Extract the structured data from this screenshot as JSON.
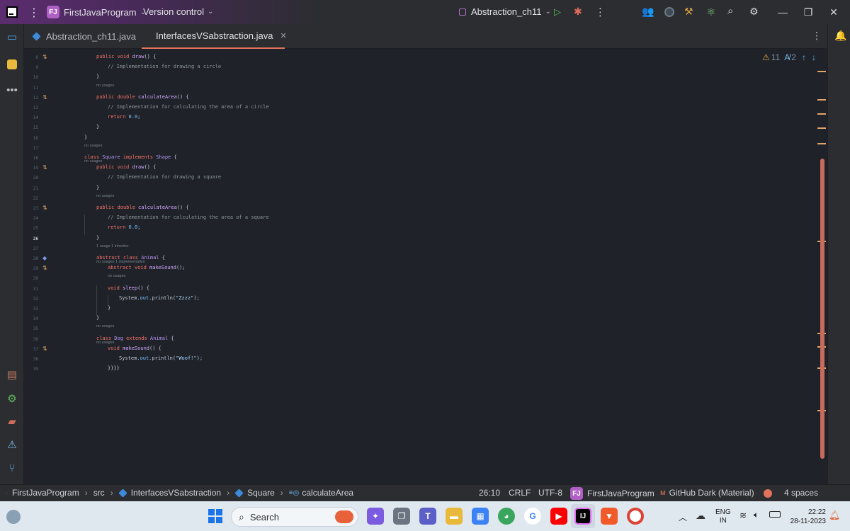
{
  "titlebar": {
    "project_badge": "FJ",
    "project_name": "FirstJavaProgram",
    "vcs": "Version control",
    "run_config": "Abstraction_ch11"
  },
  "tabs": [
    {
      "label": "Abstraction_ch11.java"
    },
    {
      "label": "InterfacesVSabstraction.java"
    }
  ],
  "inspection": {
    "warnings": "11",
    "typos": "2"
  },
  "code_lines": [
    {
      "ln": "8"
    },
    {
      "ln": "9"
    },
    {
      "ln": "10"
    },
    {
      "ln": "11"
    },
    {
      "ln": "12"
    },
    {
      "ln": "13"
    },
    {
      "ln": "14"
    },
    {
      "ln": "15"
    },
    {
      "ln": "16"
    },
    {
      "ln": "17"
    },
    {
      "ln": "18"
    },
    {
      "ln": "19"
    },
    {
      "ln": "20"
    },
    {
      "ln": "21"
    },
    {
      "ln": "22"
    },
    {
      "ln": "23"
    },
    {
      "ln": "24"
    },
    {
      "ln": "25"
    },
    {
      "ln": "26"
    },
    {
      "ln": "27"
    },
    {
      "ln": "28"
    },
    {
      "ln": "29"
    },
    {
      "ln": "30"
    },
    {
      "ln": "31"
    },
    {
      "ln": "32"
    },
    {
      "ln": "33"
    },
    {
      "ln": "34"
    },
    {
      "ln": "35"
    },
    {
      "ln": "36"
    },
    {
      "ln": "37"
    },
    {
      "ln": "38"
    },
    {
      "ln": "39"
    }
  ],
  "code": {
    "l8": [
      "public",
      " ",
      "void",
      " ",
      "draw",
      "() {"
    ],
    "l9": "// Implementation for drawing a circle",
    "l10": "}",
    "h12": "no usages",
    "l12": [
      "public",
      " ",
      "double",
      " ",
      "calculateArea",
      "() {"
    ],
    "l13": "// Implementation for calculating the area of a circle",
    "l14": [
      "return",
      " ",
      "0.0",
      ";"
    ],
    "l15": "}",
    "l16": "}",
    "h18": "no usages",
    "l18": [
      "class",
      " ",
      "Square",
      " ",
      "implements",
      " ",
      "Shape",
      " {"
    ],
    "h19": "no usages",
    "l19": [
      "public",
      " ",
      "void",
      " ",
      "draw",
      "() {"
    ],
    "l20": "// Implementation for drawing a square",
    "l21": "}",
    "h23": "no usages",
    "l23": [
      "public",
      " ",
      "double",
      " ",
      "calculateArea",
      "() ",
      "{"
    ],
    "l24": "// Implementation for calculating the area of a square",
    "l25": [
      "return",
      " ",
      "0.0",
      ";"
    ],
    "l26": "}",
    "h28": "1 usage   1 inheritor",
    "l28": [
      "abstract",
      " ",
      "class",
      " ",
      "Animal",
      " {"
    ],
    "h29": "no usages   1 implementation",
    "l29": [
      "abstract",
      " ",
      "void",
      " ",
      "makeSound",
      "();"
    ],
    "h31": "no usages",
    "l31": [
      "void",
      " ",
      "sleep",
      "() {"
    ],
    "l32": [
      "System.",
      "out",
      ".println(",
      "\"Zzzz\"",
      ");"
    ],
    "l33": "}",
    "l34": "}",
    "h36": "no usages",
    "l36": [
      "class",
      " ",
      "Dog",
      " ",
      "extends",
      " ",
      "Animal",
      " {"
    ],
    "h37": "no usages",
    "l37": [
      "void",
      " ",
      "makeSound",
      "() {"
    ],
    "l38": [
      "System.",
      "out",
      ".println(",
      "\"Woof!\"",
      ");"
    ],
    "l39": "}}}}"
  },
  "statusbar": {
    "breadcrumb": [
      "FirstJavaProgram",
      "src",
      "InterfacesVSabstraction",
      "Square",
      "calculateArea"
    ],
    "position": "26:10",
    "line_sep": "CRLF",
    "encoding": "UTF-8",
    "project_badge": "FJ",
    "project": "FirstJavaProgram",
    "theme": "GitHub Dark (Material)",
    "indent": "4 spaces"
  },
  "taskbar": {
    "search_placeholder": "Search",
    "lang": "ENG",
    "region": "IN",
    "time": "22:22",
    "date": "28-11-2023"
  },
  "colors": {
    "accent": "#e2725b",
    "keyword": "#f47067",
    "function": "#d2a8ff"
  }
}
